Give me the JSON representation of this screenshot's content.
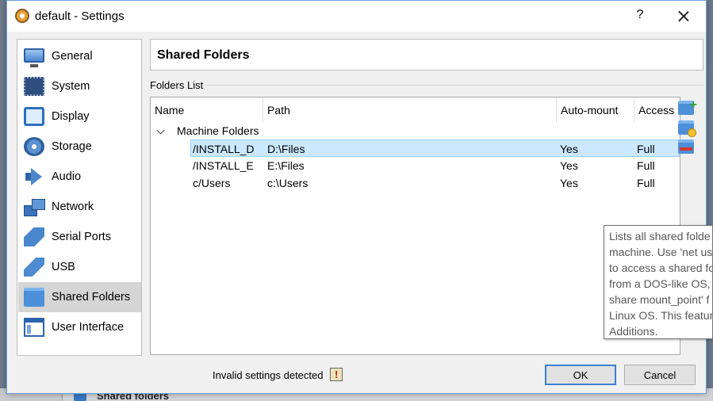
{
  "window": {
    "title": "default - Settings",
    "help_label": "?"
  },
  "sidebar": {
    "items": [
      {
        "label": "General",
        "icon": "general-icon"
      },
      {
        "label": "System",
        "icon": "system-icon"
      },
      {
        "label": "Display",
        "icon": "display-icon"
      },
      {
        "label": "Storage",
        "icon": "storage-icon"
      },
      {
        "label": "Audio",
        "icon": "audio-icon"
      },
      {
        "label": "Network",
        "icon": "network-icon"
      },
      {
        "label": "Serial Ports",
        "icon": "serial-ports-icon"
      },
      {
        "label": "USB",
        "icon": "usb-icon"
      },
      {
        "label": "Shared Folders",
        "icon": "shared-folders-icon",
        "selected": true
      },
      {
        "label": "User Interface",
        "icon": "user-interface-icon"
      }
    ]
  },
  "page": {
    "title": "Shared Folders",
    "folders_list_label": "Folders List"
  },
  "table": {
    "columns": [
      "Name",
      "Path",
      "Auto-mount",
      "Access"
    ],
    "group": "Machine Folders",
    "rows": [
      {
        "name": "/INSTALL_D",
        "path": "D:\\Files",
        "auto_mount": "Yes",
        "access": "Full",
        "selected": true
      },
      {
        "name": "/INSTALL_E",
        "path": "E:\\Files",
        "auto_mount": "Yes",
        "access": "Full"
      },
      {
        "name": "c/Users",
        "path": "c:\\Users",
        "auto_mount": "Yes",
        "access": "Full"
      }
    ]
  },
  "tooltip": {
    "lines": [
      "Lists all shared folde",
      "machine. Use 'net us",
      "to access a shared fo",
      "from a DOS-like OS,",
      "share mount_point' f",
      "Linux OS. This featur",
      "Additions."
    ]
  },
  "footer": {
    "status_text": "Invalid settings detected",
    "ok_label": "OK",
    "cancel_label": "Cancel"
  },
  "background_app": {
    "label": "Shared folders"
  }
}
